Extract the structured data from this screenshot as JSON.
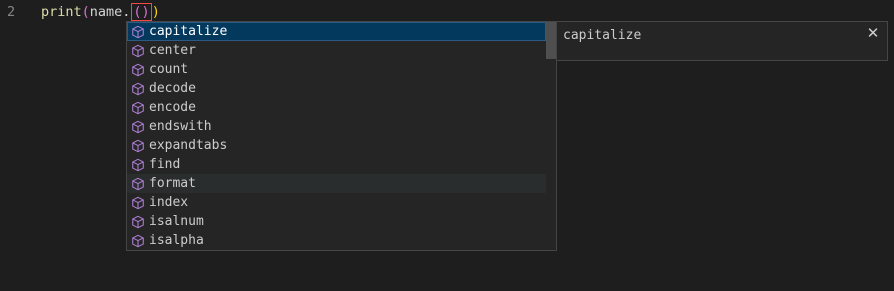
{
  "editor": {
    "line_number": "2",
    "code": {
      "fn": "print",
      "open_paren": "(",
      "var": "name.",
      "inner_parens": "()",
      "close_paren": ")"
    }
  },
  "suggest": {
    "icon": "symbol-method-icon",
    "selected_index": 0,
    "hover_index": 8,
    "items": [
      {
        "label": "capitalize"
      },
      {
        "label": "center"
      },
      {
        "label": "count"
      },
      {
        "label": "decode"
      },
      {
        "label": "encode"
      },
      {
        "label": "endswith"
      },
      {
        "label": "expandtabs"
      },
      {
        "label": "find"
      },
      {
        "label": "format"
      },
      {
        "label": "index"
      },
      {
        "label": "isalnum"
      },
      {
        "label": "isalpha"
      }
    ]
  },
  "details": {
    "title": "capitalize",
    "close_glyph": "✕"
  },
  "colors": {
    "editor_bg": "#1e1e1e",
    "widget_bg": "#252526",
    "selected_bg": "#04395e",
    "method_icon": "#b180d7"
  }
}
